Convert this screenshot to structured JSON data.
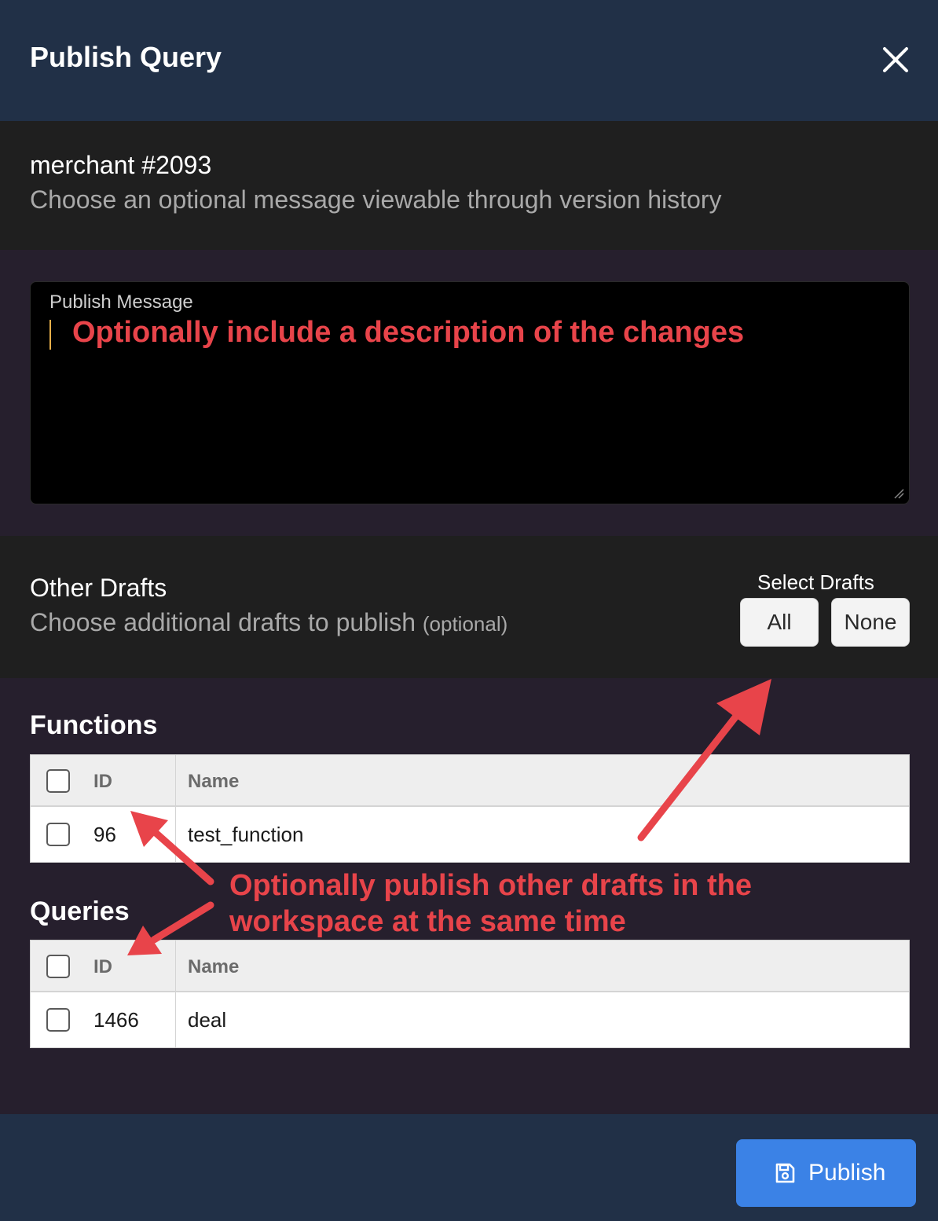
{
  "dialog": {
    "title": "Publish Query"
  },
  "info": {
    "query_name": "merchant #2093",
    "hint": "Choose an optional message viewable through version history"
  },
  "message": {
    "label": "Publish Message",
    "value": ""
  },
  "drafts": {
    "title": "Other Drafts",
    "hint": "Choose additional drafts to publish",
    "optional": "(optional)",
    "select_label": "Select Drafts",
    "all_label": "All",
    "none_label": "None"
  },
  "functions": {
    "title": "Functions",
    "columns": {
      "id": "ID",
      "name": "Name"
    },
    "rows": [
      {
        "id": "96",
        "name": "test_function",
        "checked": false
      }
    ]
  },
  "queries": {
    "title": "Queries",
    "columns": {
      "id": "ID",
      "name": "Name"
    },
    "rows": [
      {
        "id": "1466",
        "name": "deal",
        "checked": false
      }
    ]
  },
  "footer": {
    "publish_label": "Publish"
  },
  "annotations": {
    "message_note": "Optionally include a description of the changes",
    "drafts_note_line1": "Optionally publish other drafts in the",
    "drafts_note_line2": "workspace at the same time",
    "color": "#e8444a"
  },
  "colors": {
    "header_bg": "#213047",
    "panel_bg": "#1f1f1f",
    "body_bg": "#261f2d",
    "primary": "#3b82e6"
  },
  "icons": {
    "close": "close-icon",
    "publish": "save-icon",
    "resize": "resize-grip-icon"
  }
}
